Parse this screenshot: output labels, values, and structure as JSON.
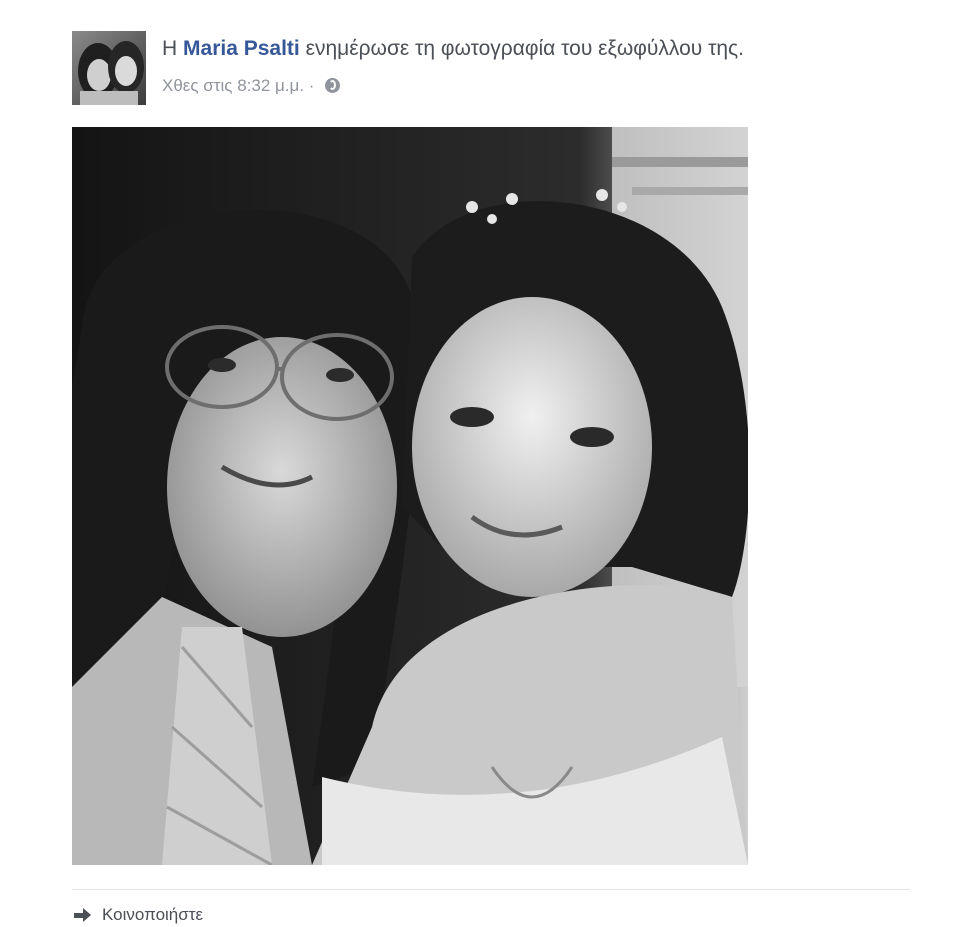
{
  "post": {
    "prefix": "Η",
    "author": "Maria Psalti",
    "action": "ενημέρωσε τη φωτογραφία του εξωφύλλου της.",
    "timestamp": "Χθες στις 8:32 μ.μ.",
    "separator": "·",
    "audience_icon": "globe-icon"
  },
  "actions": {
    "share_label": "Κοινοποιήστε",
    "share_icon": "share-arrow-icon"
  },
  "colors": {
    "author_link": "#365899",
    "meta_text": "#90949c",
    "body_text": "#4b4f56"
  }
}
